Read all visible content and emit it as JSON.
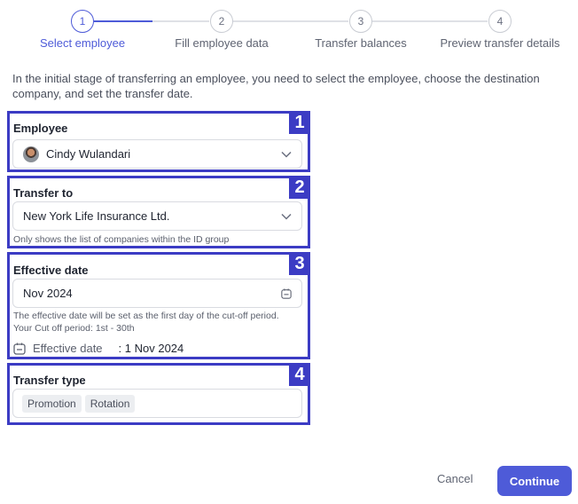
{
  "stepper": {
    "steps": [
      {
        "number": "1",
        "label": "Select employee",
        "active": true
      },
      {
        "number": "2",
        "label": "Fill employee data",
        "active": false
      },
      {
        "number": "3",
        "label": "Transfer balances",
        "active": false
      },
      {
        "number": "4",
        "label": "Preview transfer details",
        "active": false
      }
    ]
  },
  "intro": "In the initial stage of transferring an employee, you need to select the employee, choose the destination company, and set the transfer date.",
  "employee": {
    "badge": "1",
    "label": "Employee",
    "value": "Cindy Wulandari",
    "icon": "chevron-down-icon"
  },
  "transfer_to": {
    "badge": "2",
    "label": "Transfer to",
    "value": "New York Life Insurance Ltd.",
    "helper": "Only shows the list of companies within the ID group",
    "icon": "chevron-down-icon"
  },
  "effective_date": {
    "badge": "3",
    "label": "Effective date",
    "value": "Nov 2024",
    "helper_line1": "The effective date will be set as the first day of the cut-off period.",
    "helper_line2": "Your Cut off period: 1st - 30th",
    "summary_label": "Effective date",
    "summary_value": ": 1 Nov 2024",
    "icon": "calendar-icon"
  },
  "transfer_type": {
    "badge": "4",
    "label": "Transfer type",
    "options": [
      "Promotion",
      "Rotation"
    ]
  },
  "footer": {
    "cancel_label": "Cancel",
    "continue_label": "Continue"
  },
  "colors": {
    "accent": "#4e5bd8",
    "annotation": "#3c3cc4"
  }
}
